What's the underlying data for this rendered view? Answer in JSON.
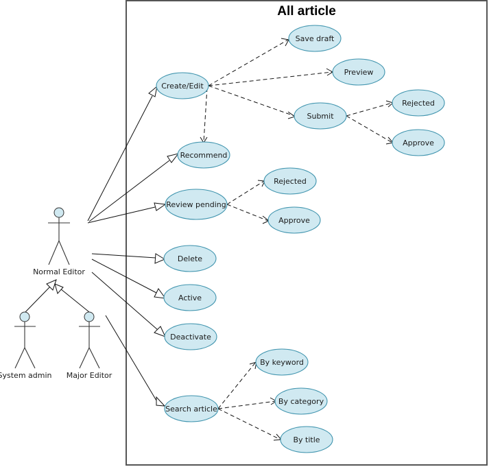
{
  "system": {
    "title": "All article"
  },
  "actors": {
    "normal_editor": "Normal Editor",
    "system_admin": "System admin",
    "major_editor": "Major Editor"
  },
  "use_cases": {
    "create_edit": "Create/Edit",
    "save_draft": "Save draft",
    "preview": "Preview",
    "submit": "Submit",
    "submit_rejected": "Rejected",
    "submit_approve": "Approve",
    "recommend": "Recommend",
    "review_pending": "Review pending",
    "review_rejected": "Rejected",
    "review_approve": "Approve",
    "delete": "Delete",
    "active": "Active",
    "deactivate": "Deactivate",
    "search_article": "Search article",
    "by_keyword": "By keyword",
    "by_category": "By category",
    "by_title": "By title"
  },
  "colors": {
    "use_case_fill": "#d0e9f1",
    "use_case_stroke": "#3e93ad",
    "boundary_stroke": "#555555"
  }
}
